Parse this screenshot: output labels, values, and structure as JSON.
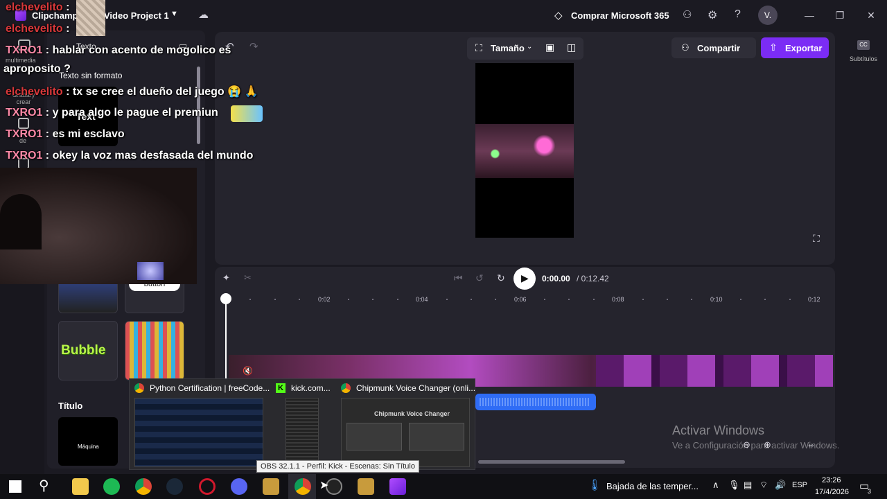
{
  "titlebar": {
    "app_name": "Clipchamp",
    "project_name": "Video Project 1",
    "buy_label": "Comprar Microsoft 365",
    "avatar_initial": "V."
  },
  "stage_toolbar": {
    "size_label": "Tamaño",
    "share_label": "Compartir",
    "export_label": "Exportar",
    "captions_label": "Subtítulos"
  },
  "left_panel": {
    "section_text_heading": "Texto",
    "plain_text_label": "Texto sin formato",
    "text_preview": "Text",
    "button_sticker_label": "button",
    "bubble_label": "Bubble",
    "title_heading": "Título",
    "title_preview": "Máquina"
  },
  "left_rail": {
    "items": [
      "multimedia",
      "Grabary crear",
      "de"
    ]
  },
  "chat": {
    "lines": [
      {
        "user": "elchevelito",
        "msg": ":",
        "color": "red"
      },
      {
        "user": "elchevelito",
        "msg": ":",
        "color": "red"
      },
      {
        "user": "TXRO1",
        "msg": ": hablar con acento de mogolico es",
        "color": "pink"
      },
      {
        "user": "",
        "msg": "aproposito ?",
        "color": "pink"
      },
      {
        "user": "elchevelito",
        "msg": ": tx se cree el dueño del juego 😭 🙏",
        "color": "red"
      },
      {
        "user": "TXRO1",
        "msg": ": y para algo le pague el premiun",
        "color": "pink"
      },
      {
        "user": "TXRO1",
        "msg": ": es mi esclavo",
        "color": "pink"
      },
      {
        "user": "TXRO1",
        "msg": ": okey la voz mas desfasada del mundo",
        "color": "pink"
      }
    ]
  },
  "playback": {
    "current_time": "0:00.00",
    "total_time": "/ 0:12.42"
  },
  "ruler": {
    "labels": [
      "0:02",
      "0:04",
      "0:06",
      "0:08",
      "0:10",
      "0:12"
    ]
  },
  "taskbar_preview": {
    "tab1_title": "Python Certification | freeCode...",
    "tab2_title": "kick.com...",
    "tab3_title": "Chipmunk Voice Changer (onli...",
    "chipmunk_heading": "Chipmunk Voice Changer"
  },
  "tooltip": {
    "text": "OBS 32.1.1 - Perfil: Kick - Escenas: Sin Título"
  },
  "watermark": {
    "title": "Activar Windows",
    "subtitle": "Ve a Configuración para activar Windows."
  },
  "taskbar": {
    "weather": "Bajada de las temper...",
    "language": "ESP",
    "time": "23:26",
    "date": "17/4/2026",
    "notif_count": "3"
  },
  "colors": {
    "accent": "#7b2cf5",
    "background": "#1b1a22",
    "audio_track": "#2f6cf5"
  }
}
